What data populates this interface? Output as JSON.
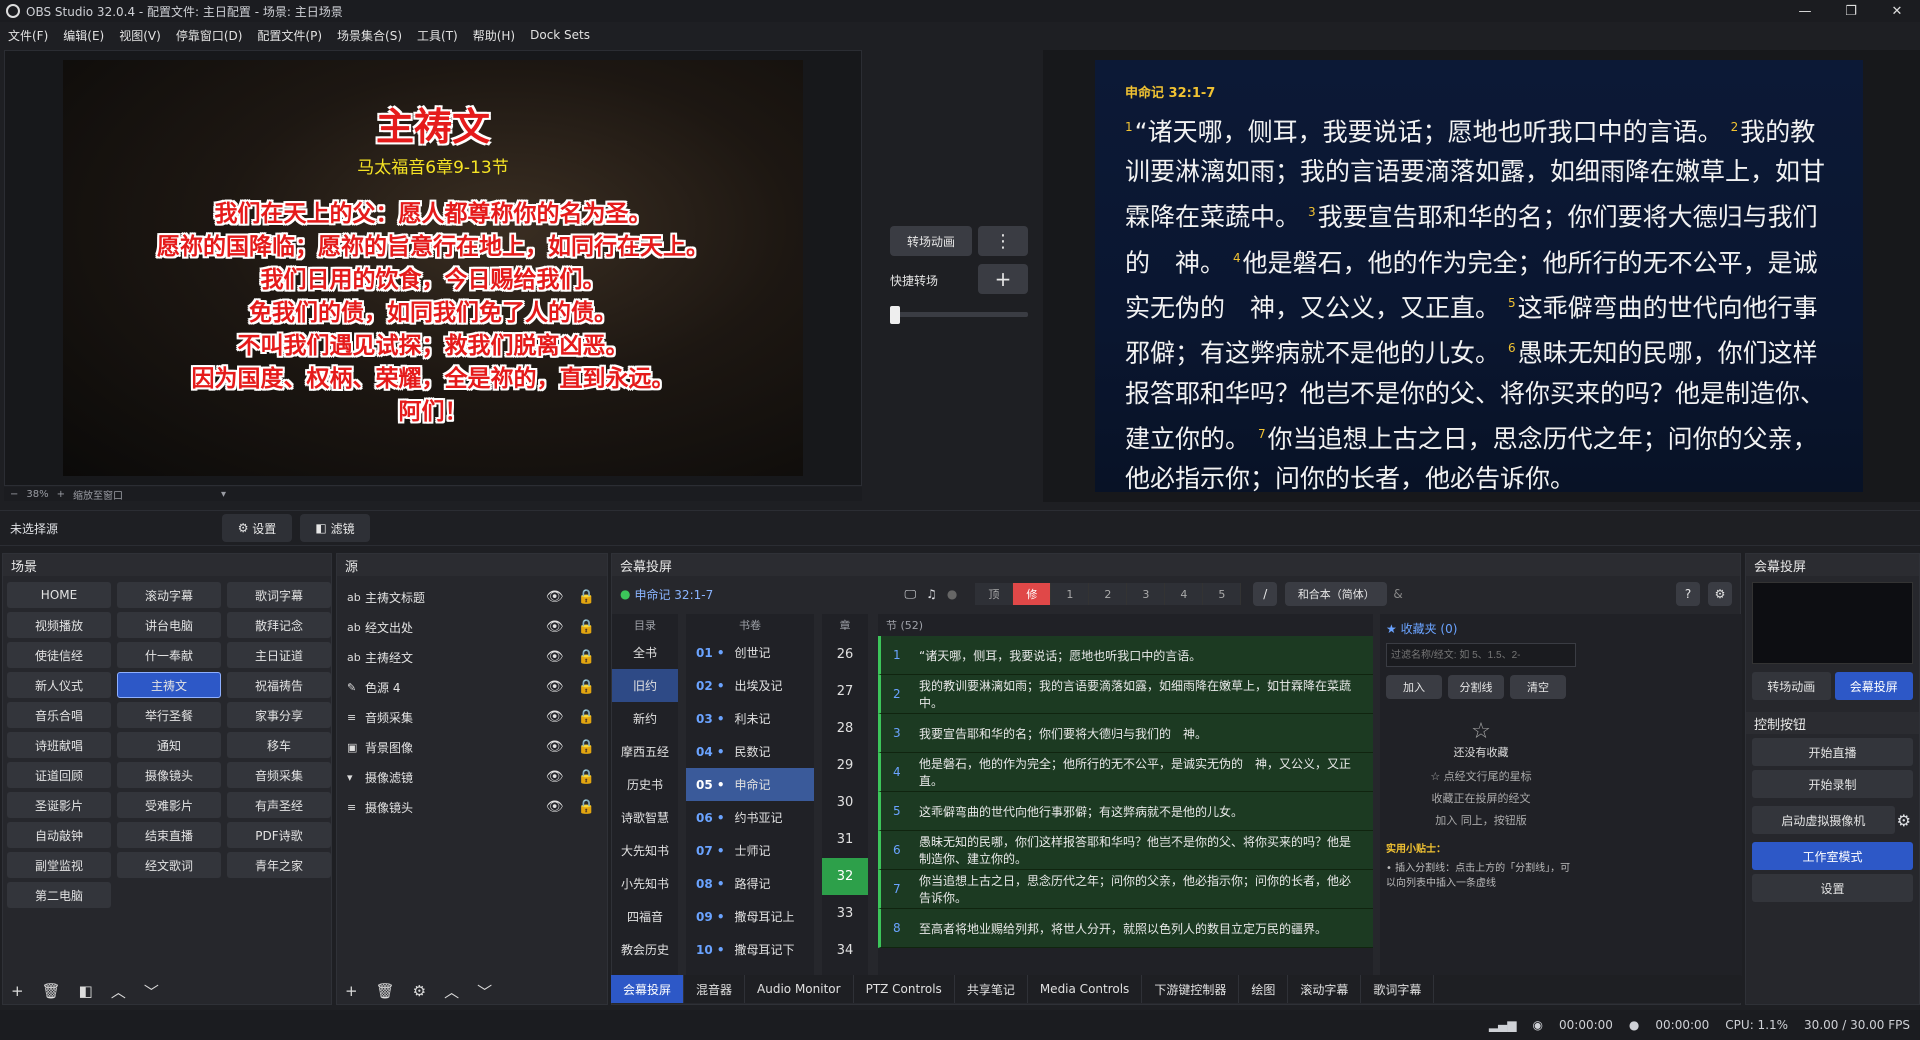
{
  "window": {
    "title": "OBS Studio 32.0.4 - 配置文件: 主日配置 - 场景: 主日场景",
    "min": "—",
    "max": "❐",
    "close": "✕"
  },
  "menu": [
    "文件(F)",
    "编辑(E)",
    "视图(V)",
    "停靠窗口(D)",
    "配置文件(P)",
    "场景集合(S)",
    "工具(T)",
    "帮助(H)",
    "Dock Sets"
  ],
  "preview": {
    "title": "主祷文",
    "ref": "马太福音6章9-13节",
    "lines": [
      "我们在天上的父：愿人都尊称你的名为圣。",
      "愿祢的国降临；愿祢的旨意行在地上，如同行在天上。",
      "我们日用的饮食，今日赐给我们。",
      "免我们的债，如同我们免了人的债。",
      "不叫我们遇见试探；救我们脱离凶恶。",
      "因为国度、权柄、荣耀，全是祢的，直到永远。",
      "阿们！"
    ],
    "zoom": "38%",
    "zoom_label": "缩放至窗口"
  },
  "transition": {
    "label": "转场动画",
    "more": "⋮",
    "quick": "快捷转场",
    "add": "+"
  },
  "program": {
    "ref": "申命记 32:1-7",
    "verses": [
      {
        "n": "1",
        "t": "“诸天哪，侧耳，我要说话；愿地也听我口中的言语。"
      },
      {
        "n": "2",
        "t": "我的教训要淋漓如雨；我的言语要滴落如露，如细雨降在嫩草上，如甘霖降在菜蔬中。"
      },
      {
        "n": "3",
        "t": "我要宣告耶和华的名；你们要将大德归与我们的　神。"
      },
      {
        "n": "4",
        "t": "他是磐石，他的作为完全；他所行的无不公平，是诚实无伪的　神，又公义，又正直。"
      },
      {
        "n": "5",
        "t": "这乖僻弯曲的世代向他行事邪僻；有这弊病就不是他的儿女。"
      },
      {
        "n": "6",
        "t": "愚昧无知的民哪，你们这样报答耶和华吗？他岂不是你的父、将你买来的吗？他是制造你、建立你的。"
      },
      {
        "n": "7",
        "t": "你当追想上古之日，思念历代之年；问你的父亲，他必指示你；问你的长者，他必告诉你。"
      }
    ]
  },
  "sourcebar": {
    "status": "未选择源",
    "settings": "设置",
    "filters": "滤镜"
  },
  "scenes": {
    "title": "场景",
    "items": [
      "HOME",
      "滚动字幕",
      "歌词字幕",
      "视频播放",
      "讲台电脑",
      "散拜记念",
      "使徒信经",
      "什一奉献",
      "主日证道",
      "新人仪式",
      "主祷文",
      "祝福祷告",
      "音乐合唱",
      "举行圣餐",
      "家事分享",
      "诗班献唱",
      "通知",
      "移车",
      "证道回顾",
      "摄像镜头",
      "音频采集",
      "圣诞影片",
      "受难影片",
      "有声圣经",
      "自动敲钟",
      "结束直播",
      "PDF诗歌",
      "副堂监视",
      "经文歌词",
      "青年之家",
      "第二电脑"
    ],
    "active": "主祷文"
  },
  "sources": {
    "title": "源",
    "items": [
      {
        "icon": "ab",
        "label": "主祷文标题"
      },
      {
        "icon": "ab",
        "label": "经文出处"
      },
      {
        "icon": "ab",
        "label": "主祷经文"
      },
      {
        "icon": "✎",
        "label": "色源 4"
      },
      {
        "icon": "≡",
        "label": "音频采集"
      },
      {
        "icon": "▣",
        "label": "背景图像"
      },
      {
        "icon": "▾",
        "label": "摄像滤镜"
      },
      {
        "icon": "≡",
        "label": "摄像镜头"
      }
    ]
  },
  "bible": {
    "title": "会幕投屏",
    "current": "申命记 32:1-7",
    "tabs": [
      "顶",
      "修",
      "1",
      "2",
      "3",
      "4",
      "5"
    ],
    "version": "和合本（简体）",
    "col_heads": {
      "cat": "目录",
      "book": "书卷",
      "chap": "章",
      "verse": "节 (52)"
    },
    "categories": [
      "全书",
      "旧约",
      "新约",
      "摩西五经",
      "历史书",
      "诗歌智慧",
      "大先知书",
      "小先知书",
      "四福音",
      "教会历史"
    ],
    "active_cat": "旧约",
    "books": [
      {
        "n": "01",
        "t": "创世记"
      },
      {
        "n": "02",
        "t": "出埃及记"
      },
      {
        "n": "03",
        "t": "利未记"
      },
      {
        "n": "04",
        "t": "民数记"
      },
      {
        "n": "05",
        "t": "申命记"
      },
      {
        "n": "06",
        "t": "约书亚记"
      },
      {
        "n": "07",
        "t": "士师记"
      },
      {
        "n": "08",
        "t": "路得记"
      },
      {
        "n": "09",
        "t": "撒母耳记上"
      },
      {
        "n": "10",
        "t": "撒母耳记下"
      }
    ],
    "active_book": "申命记",
    "chapters": [
      "26",
      "27",
      "28",
      "29",
      "30",
      "31",
      "32",
      "33",
      "34"
    ],
    "active_chap": "32",
    "verses": [
      {
        "n": "1",
        "t": "“诸天哪，侧耳，我要说话；愿地也听我口中的言语。"
      },
      {
        "n": "2",
        "t": "我的教训要淋漓如雨；我的言语要滴落如露，如细雨降在嫩草上，如甘霖降在菜蔬中。"
      },
      {
        "n": "3",
        "t": "我要宣告耶和华的名；你们要将大德归与我们的　神。"
      },
      {
        "n": "4",
        "t": "他是磐石，他的作为完全；他所行的无不公平，是诚实无伪的　神，又公义，又正直。"
      },
      {
        "n": "5",
        "t": "这乖僻弯曲的世代向他行事邪僻；有这弊病就不是他的儿女。"
      },
      {
        "n": "6",
        "t": "愚昧无知的民哪，你们这样报答耶和华吗？他岂不是你的父、将你买来的吗？他是制造你、建立你的。"
      },
      {
        "n": "7",
        "t": "你当追想上古之日，思念历代之年；问你的父亲，他必指示你；问你的长者，他必告诉你。"
      },
      {
        "n": "8",
        "t": "至高者将地业赐给列邦，将世人分开，就照以色列人的数目立定万民的疆界。"
      }
    ],
    "fav": {
      "title": "★ 收藏夹 (0)",
      "placeholder": "过滤名称/经文: 如 5、1.5、2-",
      "add": "加入",
      "split": "分割线",
      "clear": "清空",
      "empty": "还没有收藏",
      "hint1": "☆ 点经文行尾的星标",
      "hint2": "收藏正在投屏的经文",
      "hint3": "加入  同上，按钮版",
      "tips_title": "实用小贴士：",
      "tips": "• 插入分割线：点击上方的「分割线」，可以向列表中插入一条虚线"
    }
  },
  "bottom_tabs": [
    "会幕投屏",
    "混音器",
    "Audio Monitor",
    "PTZ Controls",
    "共享笔记",
    "Media Controls",
    "下游键控制器",
    "绘图",
    "滚动字幕",
    "歌词字幕"
  ],
  "rightdock": {
    "title": "会幕投屏",
    "trans": "转场动画",
    "screen": "会幕投屏",
    "controls_title": "控制按钮",
    "start_stream": "开始直播",
    "start_rec": "开始录制",
    "vcam": "启动虚拟摄像机",
    "studio": "工作室模式",
    "settings": "设置"
  },
  "status": {
    "stream_time": "00:00:00",
    "rec_time": "00:00:00",
    "cpu": "CPU: 1.1%",
    "fps": "30.00 / 30.00 FPS"
  },
  "colors": {
    "accent": "#2d58c7",
    "verse_bg": "#1c3a22",
    "verse_bar": "#3cc55a",
    "prayer_red": "#e51b1b"
  }
}
